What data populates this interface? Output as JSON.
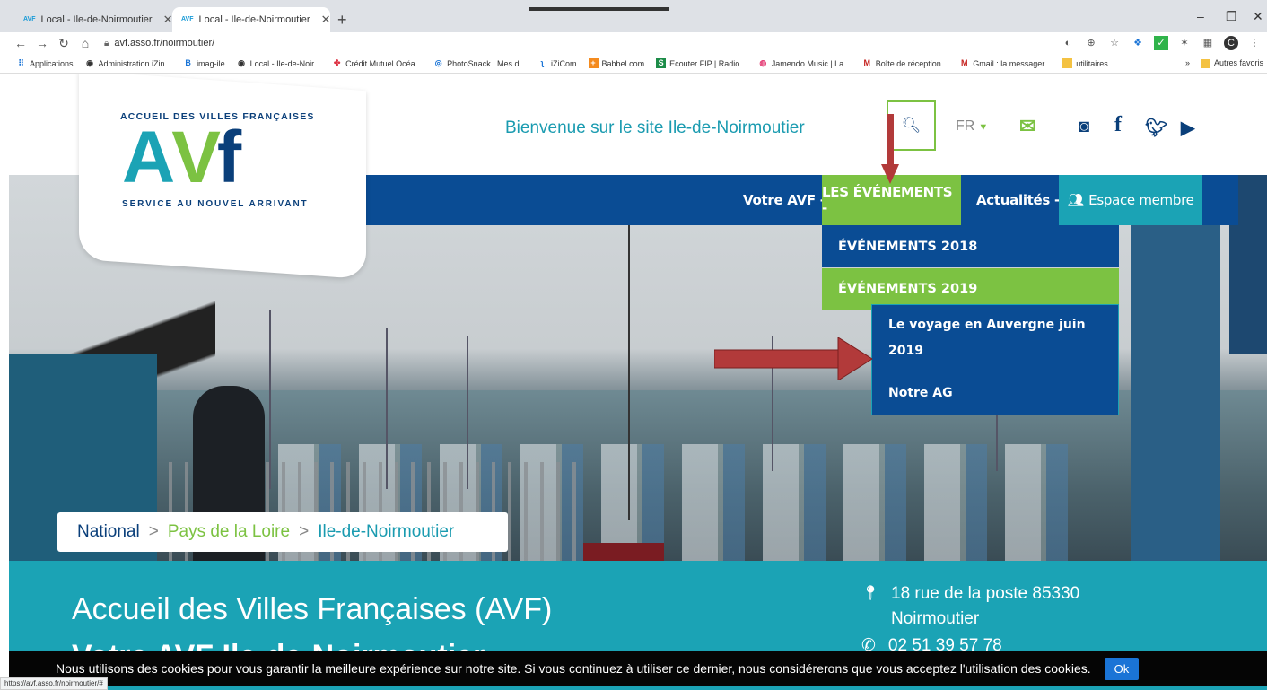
{
  "browser": {
    "tabs": [
      {
        "label": "Local - Ile-de-Noirmoutier",
        "favicon": "AVF",
        "active": false
      },
      {
        "label": "Local - Ile-de-Noirmoutier",
        "favicon": "AVF",
        "active": true
      }
    ],
    "new_tab": "+",
    "url": "avf.asso.fr/noirmoutier/",
    "bookmarks": [
      "Applications",
      "Administration iZin...",
      "imag-ile",
      "Local - Ile-de-Noir...",
      "Crédit Mutuel Océa...",
      "PhotoSnack | Mes d...",
      "iZiCom",
      "Babbel.com",
      "Ecouter FIP | Radio...",
      "Jamendo Music | La...",
      "Boîte de réception...",
      "Gmail : la messager...",
      "utilitaires"
    ],
    "bookmarks_overflow": "»",
    "other_bookmarks": "Autres favoris",
    "status_url": "https://avf.asso.fr/noirmoutier/#"
  },
  "logo": {
    "top_text": "ACCUEIL DES VILLES FRANÇAISES",
    "bottom_text": "SERVICE AU NOUVEL ARRIVANT",
    "mark_a": "A",
    "mark_v": "V",
    "mark_f": "f"
  },
  "header": {
    "welcome": "Bienvenue sur le site Ile-de-Noirmoutier",
    "lang": "FR"
  },
  "nav": {
    "votre_avf": "Votre AVF -",
    "events": "LES ÉVÉNEMENTS -",
    "actualites": "Actualités -",
    "espace_membre": "Espace membre"
  },
  "dropdown": {
    "items": [
      "ÉVÉNEMENTS 2018",
      "ÉVÉNEMENTS 2019"
    ],
    "sub_items": [
      "Le voyage en Auvergne juin 2019",
      "Notre AG"
    ]
  },
  "breadcrumb": {
    "items": [
      "National",
      "Pays de la Loire",
      "Ile-de-Noirmoutier"
    ],
    "separator": ">"
  },
  "main": {
    "title": "Accueil des Villes Françaises (AVF)",
    "title2": "Votre AVF Ile-de-Noirmoutier",
    "address": "18 rue de la poste 85330 Noirmoutier",
    "phone": "02 51 39 57 78"
  },
  "cookie": {
    "text": "Nous utilisons des cookies pour vous garantir la meilleure expérience sur notre site. Si vous continuez à utiliser ce dernier, nous considérerons que vous acceptez l'utilisation des cookies.",
    "ok": "Ok"
  },
  "colors": {
    "navy": "#0a4c94",
    "green": "#7cc242",
    "teal": "#1ba3b5",
    "arrow": "#b23a3a"
  }
}
